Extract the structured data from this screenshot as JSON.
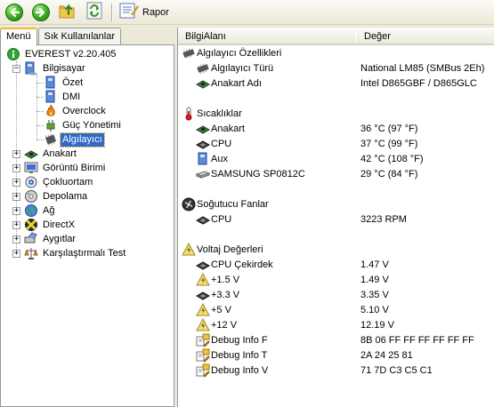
{
  "toolbar": {
    "back_icon": "back-arrow-icon",
    "forward_icon": "forward-arrow-icon",
    "up_icon": "folder-up-icon",
    "refresh_icon": "refresh-icon",
    "report_label": "Rapor"
  },
  "tabs": [
    {
      "label": "Menü",
      "active": true
    },
    {
      "label": "Sık Kullanılanlar",
      "active": false
    }
  ],
  "tree": {
    "root": "EVEREST v2.20.405",
    "computer": "Bilgisayar",
    "computer_children": [
      "Özet",
      "DMI",
      "Overclock",
      "Güç Yönetimi",
      "Algılayıcı"
    ],
    "selected": "Algılayıcı",
    "top_items": [
      "Anakart",
      "Görüntü Birimi",
      "Çokluortam",
      "Depolama",
      "Ağ",
      "DirectX",
      "Aygıtlar",
      "Karşılaştırmalı Test"
    ]
  },
  "columns": {
    "field": "BilgiAlanı",
    "value": "Değer"
  },
  "sections": [
    {
      "title": "Algılayıcı Özellikleri",
      "icon": "sensor-chip-icon",
      "items": [
        {
          "name": "Algılayıcı Türü",
          "value": "National LM85  (SMBus 2Eh)",
          "icon": "sensor-chip-icon"
        },
        {
          "name": "Anakart Adı",
          "value": "Intel D865GBF / D865GLC",
          "icon": "motherboard-icon"
        }
      ]
    },
    {
      "title": "Sıcaklıklar",
      "icon": "thermometer-icon",
      "items": [
        {
          "name": "Anakart",
          "value": "36 °C  (97 °F)",
          "icon": "motherboard-icon"
        },
        {
          "name": "CPU",
          "value": "37 °C  (99 °F)",
          "icon": "cpu-icon"
        },
        {
          "name": "Aux",
          "value": "42 °C  (108 °F)",
          "icon": "aux-computer-icon"
        },
        {
          "name": "SAMSUNG SP0812C",
          "value": "29 °C  (84 °F)",
          "icon": "hard-disk-icon"
        }
      ]
    },
    {
      "title": "Soğutucu Fanlar",
      "icon": "fan-icon",
      "items": [
        {
          "name": "CPU",
          "value": "3223 RPM",
          "icon": "cpu-icon"
        }
      ]
    },
    {
      "title": "Voltaj Değerleri",
      "icon": "voltage-warning-icon",
      "items": [
        {
          "name": "CPU Çekirdek",
          "value": "1.47 V",
          "icon": "cpu-icon"
        },
        {
          "name": "+1.5 V",
          "value": "1.49 V",
          "icon": "voltage-warning-icon"
        },
        {
          "name": "+3.3 V",
          "value": "3.35 V",
          "icon": "cpu-icon"
        },
        {
          "name": "+5 V",
          "value": "5.10 V",
          "icon": "voltage-warning-icon"
        },
        {
          "name": "+12 V",
          "value": "12.19 V",
          "icon": "voltage-warning-icon"
        },
        {
          "name": "Debug Info F",
          "value": "8B 06 FF FF FF FF FF FF",
          "icon": "debug-info-icon"
        },
        {
          "name": "Debug Info T",
          "value": "2A 24 25 81",
          "icon": "debug-info-icon"
        },
        {
          "name": "Debug Info V",
          "value": "71 7D C3 C5 C1",
          "icon": "debug-info-icon"
        }
      ]
    }
  ]
}
